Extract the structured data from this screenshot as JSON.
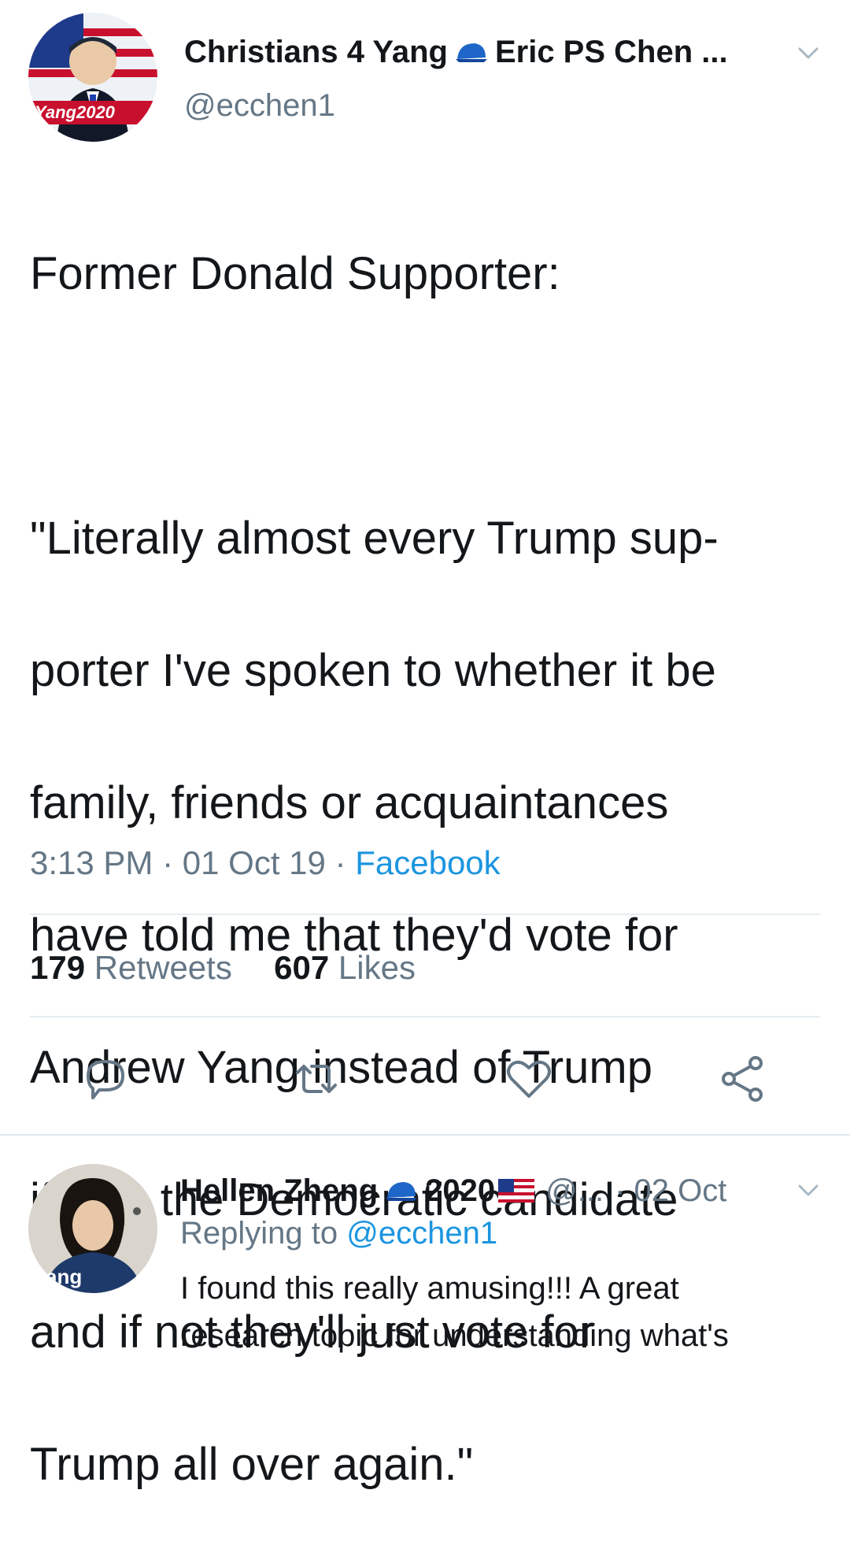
{
  "tweet": {
    "display_name_part1": "Christians 4 Yang",
    "display_name_part2": "Eric PS Chen ...",
    "handle": "@ecchen1",
    "avatar_badge_text": "Yang2020",
    "icon_after_name": "blue-cap-icon",
    "text_lines": [
      "Former Donald Supporter:",
      "",
      "\"Literally almost every Trump sup-",
      "porter I've spoken to whether it be",
      "family, friends or acquaintances",
      "have told me that they'd vote for",
      "Andrew Yang instead of Trump",
      "if he's the Democratic candidate",
      "and if not they'll just vote for",
      "Trump all over again.\""
    ],
    "time": "3:13 PM",
    "separator": "·",
    "date": "01 Oct 19",
    "source": "Facebook",
    "retweets_count": "179",
    "retweets_label": "Retweets",
    "likes_count": "607",
    "likes_label": "Likes",
    "actions": [
      "reply-icon",
      "retweet-icon",
      "like-icon",
      "share-icon"
    ]
  },
  "reply": {
    "display_name": "Hellen Zheng",
    "name_suffix": "2020",
    "handle": "@...",
    "date": "· 02 Oct",
    "replying_to_label": "Replying to",
    "replying_to_handle": "@ecchen1",
    "avatar_shirt_text": "ang",
    "text_lines": [
      "I found this really amusing!!! A great",
      "research topic for understanding what's"
    ]
  },
  "colors": {
    "text": "#14171a",
    "secondary": "#657786",
    "link": "#1b95e0",
    "divider": "#e6ecf0"
  }
}
